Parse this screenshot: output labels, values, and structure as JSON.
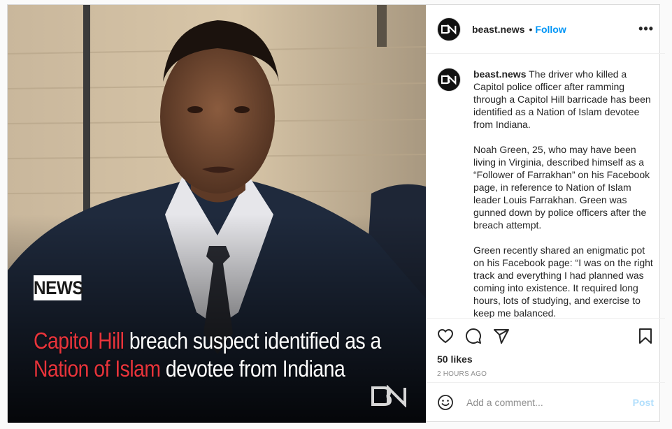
{
  "post": {
    "image": {
      "badge": "NEWS",
      "headline": {
        "line1_highlight": "Capitol Hill",
        "line1_rest": " breach suspect identified as a",
        "line2_highlight": "Nation of Islam",
        "line2_rest": " devotee from Indiana"
      },
      "highlight_color": "#e8343b",
      "watermark_icon": "beast-news-logo-icon"
    },
    "header": {
      "username": "beast.news",
      "separator": "•",
      "follow_label": "Follow",
      "more_icon": "•••"
    },
    "caption": {
      "username": "beast.news",
      "paragraphs": [
        "The driver who killed a Capitol police officer after ramming through a Capitol Hill barricade has been identified as a Nation of Islam devotee from Indiana.",
        "Noah Green, 25, who may have been living in Virginia, described himself as a “Follower of Farrakhan” on his Facebook page, in reference to Nation of Islam leader Louis Farrakhan. Green was gunned down by police officers after the breach attempt.",
        "Green recently shared an enigmatic pot on his Facebook page: “I was on the right track and everything I had planned was coming into existence. It required long hours, lots of studying, and exercise to keep me balanced."
      ]
    },
    "actions": {
      "icons": [
        "heart-icon",
        "comment-icon",
        "share-icon",
        "bookmark-icon"
      ],
      "likes": "50 likes",
      "timestamp": "2 HOURS AGO"
    },
    "comment": {
      "emoji_icon": "smiley-icon",
      "placeholder": "Add a comment...",
      "post_label": "Post"
    },
    "colors": {
      "follow": "#0095f6",
      "post_disabled": "#b2dffc",
      "border": "#dbdbdb",
      "muted": "#8e8e8e"
    }
  }
}
